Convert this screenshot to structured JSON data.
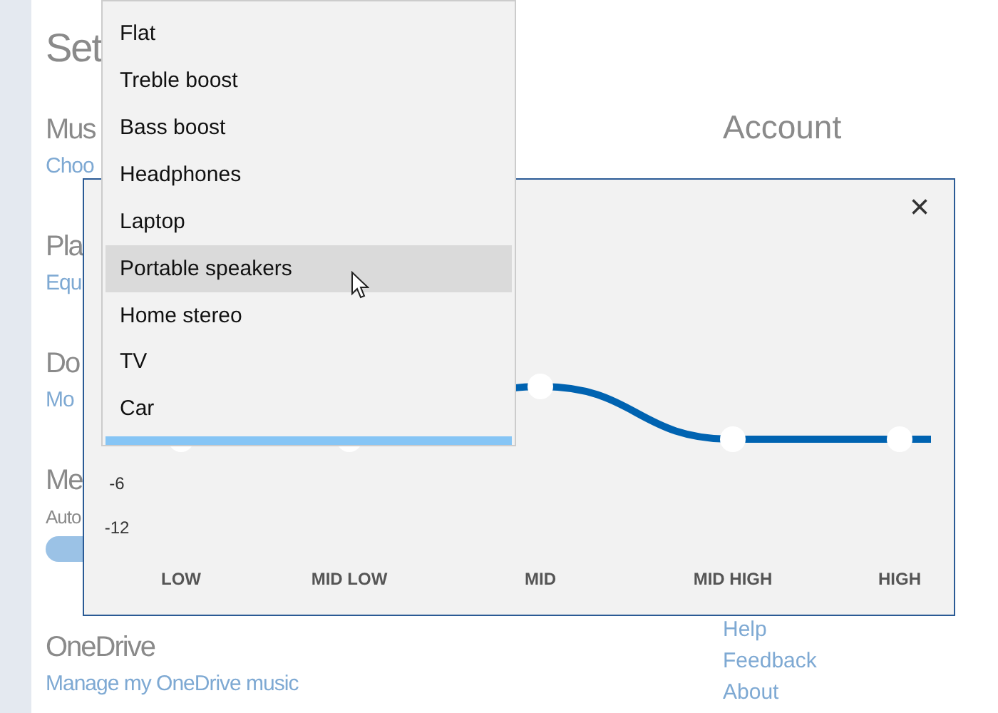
{
  "page": {
    "title": "Set",
    "sections": [
      {
        "heading": "Mus",
        "link": "Choo"
      },
      {
        "heading": "Pla",
        "link": "Equ"
      },
      {
        "heading": "Do",
        "link": "Mo"
      },
      {
        "heading": "Me",
        "text": "Auto",
        "toggle": {
          "on": true
        }
      },
      {
        "heading": "OneDrive",
        "link": "Manage my OneDrive music"
      }
    ],
    "side": {
      "heading": "Account",
      "links": [
        "Help",
        "Feedback",
        "About"
      ]
    }
  },
  "equalizer_dialog": {
    "close": "×",
    "y_labels": [
      "-6",
      "-12"
    ],
    "bands": [
      "LOW",
      "MID LOW",
      "MID",
      "MID HIGH",
      "HIGH"
    ]
  },
  "preset_menu": {
    "items": [
      {
        "label": "Flat",
        "highlighted": false
      },
      {
        "label": "Treble boost",
        "highlighted": false
      },
      {
        "label": "Bass boost",
        "highlighted": false
      },
      {
        "label": "Headphones",
        "highlighted": false
      },
      {
        "label": "Laptop",
        "highlighted": false
      },
      {
        "label": "Portable speakers",
        "highlighted": true
      },
      {
        "label": "Home stereo",
        "highlighted": false
      },
      {
        "label": "TV",
        "highlighted": false
      },
      {
        "label": "Car",
        "highlighted": false
      }
    ]
  }
}
